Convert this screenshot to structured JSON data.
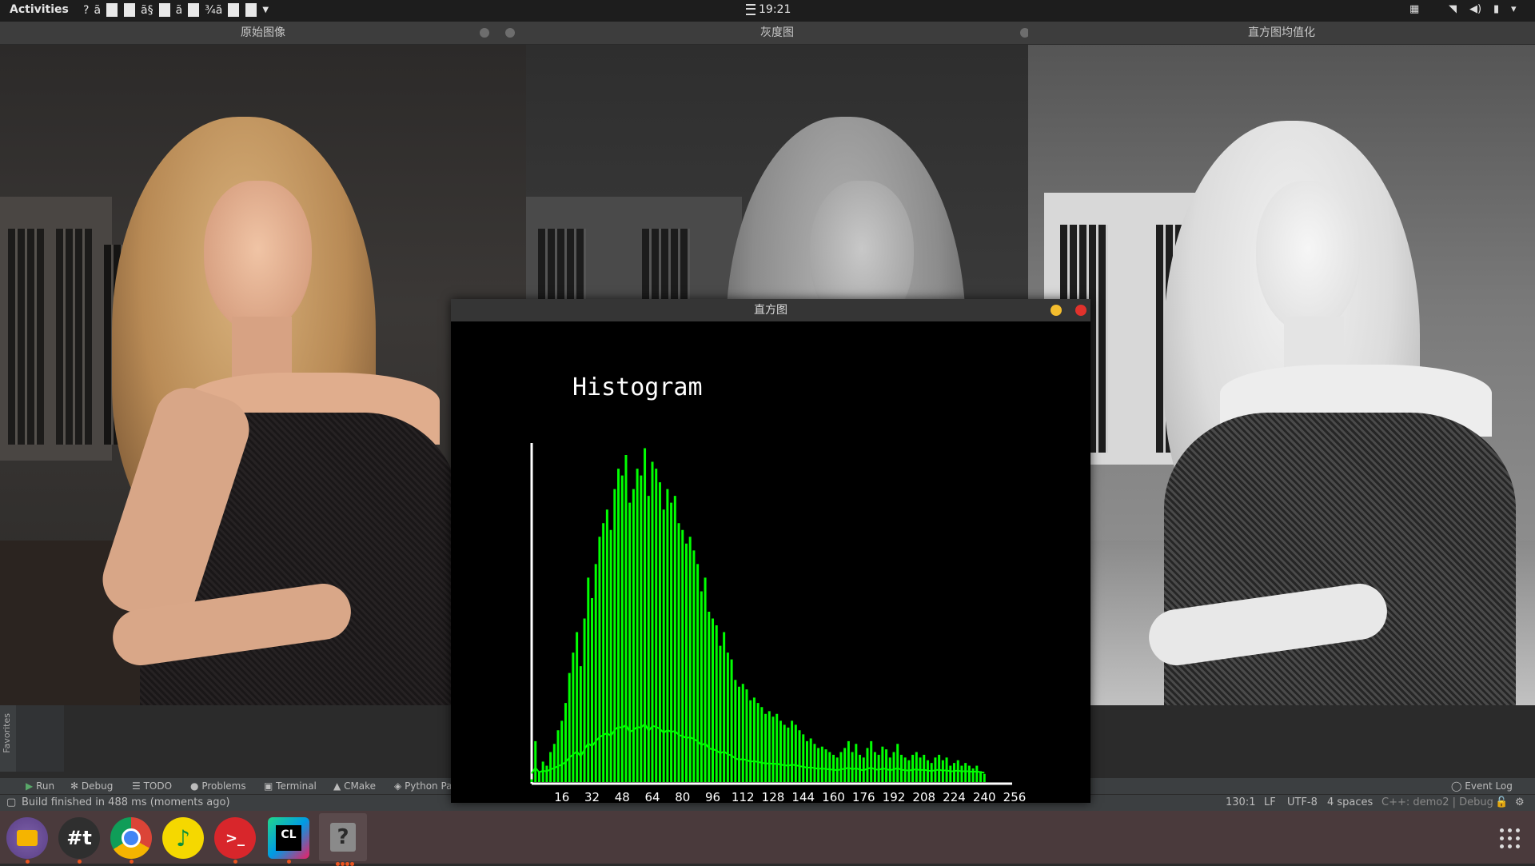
{
  "topbar": {
    "activities": "Activities",
    "app_menu_text_1": "?",
    "app_menu_text_2": "ã",
    "app_menu_text_3": "ã§",
    "app_menu_text_4": "ã",
    "app_menu_text_5": "¾ã",
    "clock": "19:21"
  },
  "windows": {
    "original": {
      "title": "原始图像"
    },
    "gray": {
      "title": "灰度图"
    },
    "equalized": {
      "title": "直方图均值化"
    },
    "histogram": {
      "title": "直方图"
    }
  },
  "histogram": {
    "label": "Histogram",
    "line_color": "#00ff00",
    "ticks": [
      "16",
      "32",
      "48",
      "64",
      "80",
      "96",
      "112",
      "128",
      "144",
      "160",
      "176",
      "192",
      "208",
      "224",
      "240",
      "256"
    ]
  },
  "chart_data": {
    "type": "line",
    "title": "Histogram",
    "xlabel": "",
    "ylabel": "",
    "xlim": [
      0,
      256
    ],
    "x": [
      0,
      2,
      4,
      6,
      8,
      10,
      12,
      14,
      16,
      18,
      20,
      22,
      24,
      26,
      28,
      30,
      32,
      34,
      36,
      38,
      40,
      42,
      44,
      46,
      48,
      50,
      52,
      54,
      56,
      58,
      60,
      62,
      64,
      66,
      68,
      70,
      72,
      74,
      76,
      78,
      80,
      82,
      84,
      86,
      88,
      90,
      92,
      94,
      96,
      98,
      100,
      102,
      104,
      106,
      108,
      110,
      112,
      114,
      116,
      118,
      120,
      122,
      124,
      126,
      128,
      130,
      132,
      134,
      136,
      138,
      140,
      142,
      144,
      146,
      148,
      150,
      152,
      154,
      156,
      158,
      160,
      162,
      164,
      166,
      168,
      170,
      172,
      174,
      176,
      178,
      180,
      182,
      184,
      186,
      188,
      190,
      192,
      194,
      196,
      198,
      200,
      202,
      204,
      206,
      208,
      210,
      212,
      214,
      216,
      218,
      220,
      222,
      224,
      226,
      228,
      230,
      232,
      234,
      236,
      238,
      240
    ],
    "values": [
      2,
      30,
      8,
      15,
      12,
      22,
      28,
      38,
      45,
      58,
      80,
      95,
      110,
      85,
      120,
      150,
      135,
      160,
      180,
      190,
      200,
      185,
      215,
      230,
      225,
      240,
      205,
      215,
      230,
      225,
      245,
      210,
      235,
      230,
      220,
      200,
      215,
      205,
      210,
      190,
      185,
      175,
      180,
      170,
      160,
      140,
      150,
      125,
      120,
      115,
      100,
      110,
      95,
      90,
      75,
      70,
      72,
      68,
      60,
      62,
      58,
      55,
      50,
      52,
      48,
      50,
      45,
      42,
      40,
      45,
      42,
      38,
      35,
      30,
      32,
      28,
      25,
      26,
      24,
      22,
      20,
      18,
      22,
      25,
      30,
      22,
      28,
      20,
      18,
      25,
      30,
      22,
      20,
      26,
      24,
      18,
      22,
      28,
      20,
      18,
      16,
      20,
      22,
      18,
      20,
      16,
      14,
      18,
      20,
      16,
      18,
      12,
      14,
      16,
      12,
      14,
      12,
      10,
      12,
      8,
      6
    ],
    "series_color": "#00ff00"
  },
  "ide": {
    "favorites": "Favorites",
    "tabs": [
      "Run",
      "Debug",
      "TODO",
      "Problems",
      "Terminal",
      "CMake",
      "Python Pa"
    ],
    "event_log": "Event Log",
    "status_left": "Build finished in 488 ms (moments ago)",
    "status_right": [
      "130:1",
      "LF",
      "UTF-8",
      "4 spaces",
      "C++: demo2 | Debug"
    ]
  },
  "dock": {
    "apps": [
      "Files",
      "Typora",
      "Chrome",
      "Music",
      "Terminal",
      "CLion",
      "Unknown App"
    ],
    "terminal_glyph": ">_",
    "clion_glyph": "CL",
    "unknown_glyph": "?"
  }
}
